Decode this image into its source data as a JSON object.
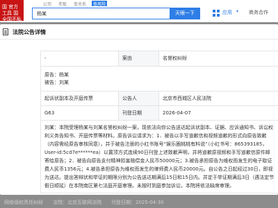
{
  "top": {
    "logo_text": "国 官方 工具 国 全国不私构",
    "tabs": [
      "公司",
      "老板",
      "查关系",
      "查风险"
    ],
    "search_value": "杨某",
    "search_button": "天眼一下",
    "app_label": "应用",
    "app_caret": "▾",
    "service_label": "商务合作"
  },
  "modal": {
    "title": "法院公告详情",
    "rows": {
      "r1_left": "-",
      "r1_label": "案由",
      "r1_value": "名誉权纠纷",
      "r2_left_line1": "原告：杨某",
      "r2_left_line2": "被告：刘某",
      "r3_left": "起诉状副本及开庭传票",
      "r3_label": "公告人",
      "r3_value": "北京市西城区人民法院",
      "r4_left": "G63",
      "r4_label": "刊登日期",
      "r4_value": "2026-04-07"
    },
    "content": "刘某：本院受理杨某与刘某名誉权纠纷一案，现依法向你公告送达起诉状副本、证据、应诉通知书、诉讼权利义务告知书、开庭传票等材料。原告诉讼请求为：1．被告以手写道歉信和视频道歉的形式向原告致歉（内容需经原告审核同意），并于被告注册的小红书账号“娱乐圈桃桃有料说”（小红书号：865393185，User-id:5cd7e******ea）以置顶方式连续90日刊登上述致歉声明，并将道歉原视频和手写道歉信原件邮寄给原告；2．被告向原告支付精神损害赔偿金人民币50000元；3.被告承担原告为维权而发生的电子取证费人民币1356元；4.被告承担原告为维权而发生的律师费人民币20000元。自公告之日起经过30日，即视为送达。提出答辩状和举证的期限分别为公告送达期满后15日和15日内。并定于举证期满后3日（遇法定节假日顺延）在本院南区第七法庭开庭审理。未按时到庭参加诉讼，本院将依法缺席审理。"
  },
  "background_bottom": {
    "left": "网络侵权责任纠纷",
    "mid_label": "法院：北京互联网法院",
    "date_label": "刊登日期：2025-04-30"
  }
}
